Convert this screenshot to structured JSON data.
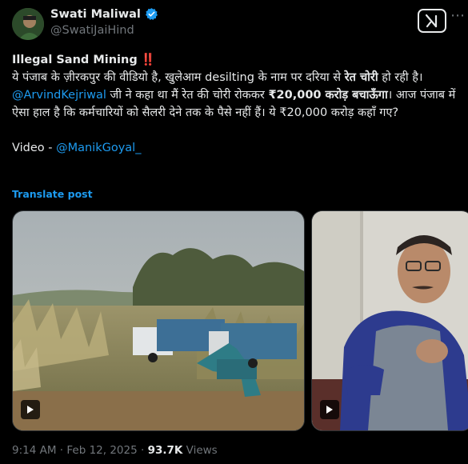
{
  "author": {
    "display_name": "Swati Maliwal",
    "handle": "@SwatiJaiHind"
  },
  "tweet": {
    "title": "Illegal Sand Mining",
    "title_emoji": "‼️",
    "line1_pre": "ये पंजाब के ज़ीरकपुर की वीडियो है, खुलेआम desilting के नाम पर दरिया से ",
    "line1_bold": "रेत चोरी",
    "line1_post": " हो रही है। ",
    "mention1": "@ArvindKejriwal",
    "line2_mid": " जी ने कहा था मैं रेत की चोरी रोककर ",
    "line2_bold": "₹20,000 करोड़ बचाऊँगा",
    "line2_post": "। आज पंजाब में ऐसा हाल है कि कर्मचारियों को सैलरी देने तक के पैसे नहीं हैं। ये ₹20,000 करोड़ कहाँ गए?",
    "video_prefix": "Video - ",
    "mention2": "@ManikGoyal_"
  },
  "translate_label": "Translate post",
  "meta": {
    "time": "9:14 AM",
    "sep1": " · ",
    "date": "Feb 12, 2025",
    "sep2": " · ",
    "views_count": "93.7K",
    "views_label": " Views"
  },
  "icons": {
    "verified": "verified-badge-icon",
    "grok": "grok-icon",
    "more": "more-icon",
    "play": "play-icon"
  },
  "colors": {
    "background": "#000000",
    "text": "#e7e9ea",
    "secondary": "#71767b",
    "link": "#1d9bf0",
    "verified": "#1d9bf0"
  }
}
